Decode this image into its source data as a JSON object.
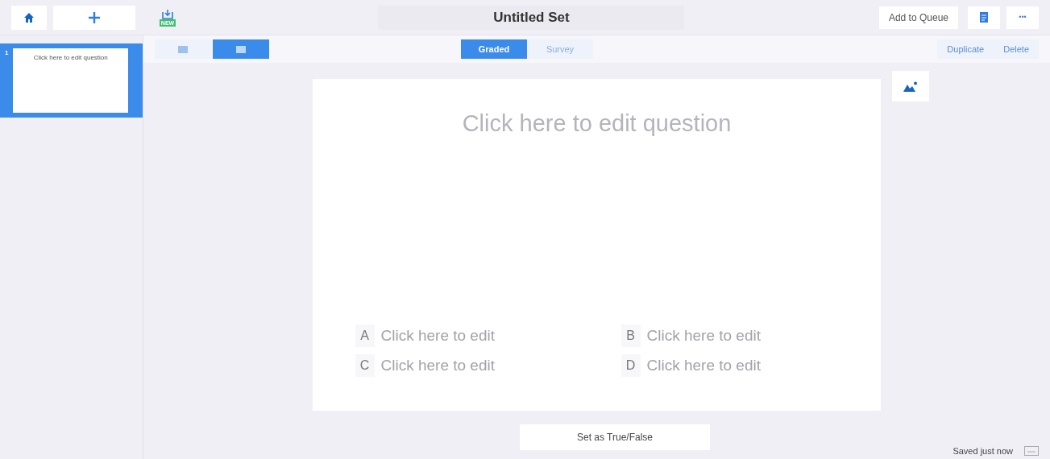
{
  "top_bar": {
    "title": "Untitled Set",
    "new_badge": "NEW",
    "queue_button": "Add to Queue",
    "more_button": "•••"
  },
  "view_toggle": [
    {
      "selected": false
    },
    {
      "selected": true
    }
  ],
  "mode_tabs": [
    {
      "label": "Graded",
      "selected": true
    },
    {
      "label": "Survey",
      "selected": false
    }
  ],
  "actions": [
    "Duplicate",
    "Delete"
  ],
  "slides": [
    {
      "number": "1",
      "text": "Click here to edit question",
      "selected": true
    }
  ],
  "question": {
    "text": "Click here to edit question"
  },
  "answers": [
    {
      "letter": "A",
      "text": "Click here to edit"
    },
    {
      "letter": "B",
      "text": "Click here to edit"
    },
    {
      "letter": "C",
      "text": "Click here to edit"
    },
    {
      "letter": "D",
      "text": "Click here to edit"
    }
  ],
  "footer": {
    "button": "Set as True/False",
    "status": "Saved just now"
  }
}
